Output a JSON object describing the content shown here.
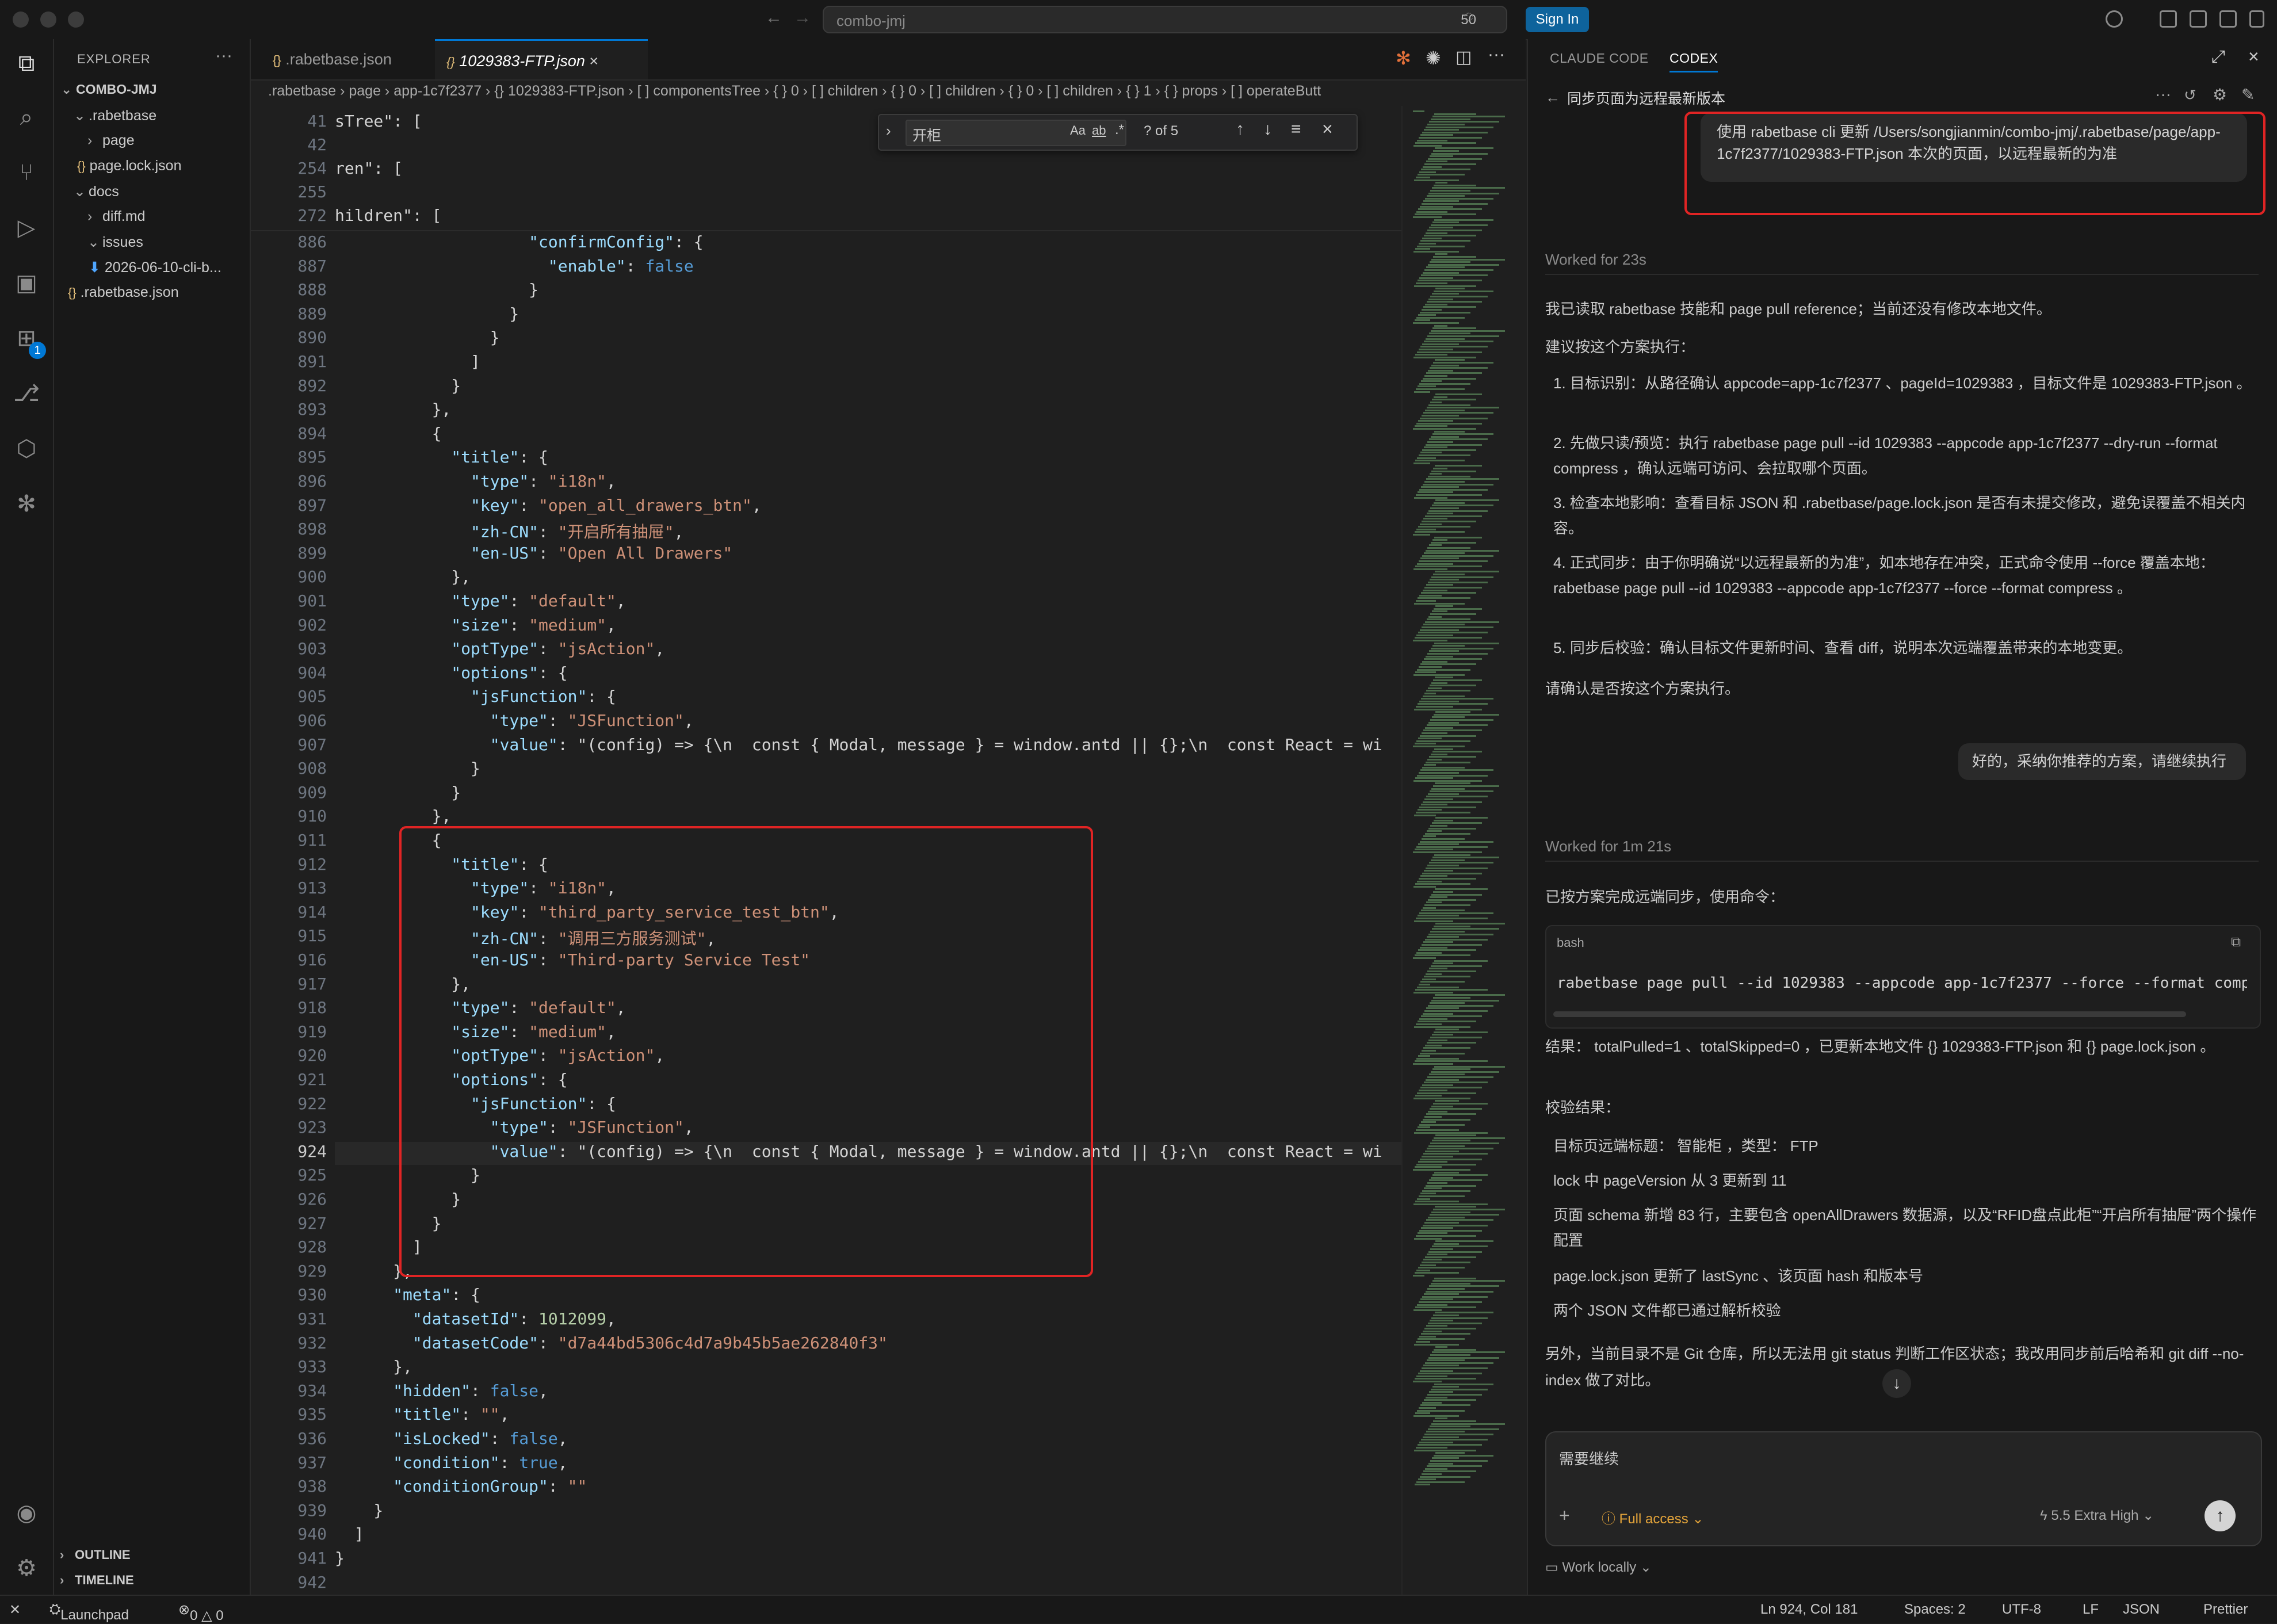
{
  "titlebar": {
    "command_center": "combo-jmj",
    "count": "50",
    "signin": "Sign In"
  },
  "activity": {
    "extensions_badge": "1"
  },
  "explorer": {
    "header": "EXPLORER",
    "root": "COMBO-JMJ",
    "items": [
      ".rabetbase",
      "page",
      "page.lock.json",
      "docs",
      "diff.md",
      "issues",
      "2026-06-10-cli-b...",
      ".rabetbase.json"
    ],
    "outline": "OUTLINE",
    "timeline": "TIMELINE"
  },
  "editor": {
    "tabs": [
      ".rabetbase.json",
      "1029383-FTP.json"
    ],
    "breadcrumb": ".rabetbase  ›  page  ›  app-1c7f2377  ›  {} 1029383-FTP.json  ›  [ ] componentsTree  ›  { } 0  ›  [ ] children  ›  { } 0  ›  [ ] children  ›  { } 0  ›  [ ] children  ›  { } 1  ›  { } props  ›  [ ] operateButt",
    "find": {
      "query": "开柜",
      "result": "? of 5"
    },
    "sticky": [
      {
        "n": "41",
        "t": "sTree\": ["
      },
      {
        "n": "42",
        "t": ""
      },
      {
        "n": "254",
        "t": "ren\": ["
      },
      {
        "n": "255",
        "t": ""
      },
      {
        "n": "272",
        "t": "hildren\": ["
      }
    ],
    "lines": [
      {
        "n": "886",
        "t": "                    \"confirmConfig\": {"
      },
      {
        "n": "887",
        "t": "                      \"enable\": false"
      },
      {
        "n": "888",
        "t": "                    }"
      },
      {
        "n": "889",
        "t": "                  }"
      },
      {
        "n": "890",
        "t": "                }"
      },
      {
        "n": "891",
        "t": "              ]"
      },
      {
        "n": "892",
        "t": "            }"
      },
      {
        "n": "893",
        "t": "          },"
      },
      {
        "n": "894",
        "t": "          {"
      },
      {
        "n": "895",
        "t": "            \"title\": {"
      },
      {
        "n": "896",
        "t": "              \"type\": \"i18n\","
      },
      {
        "n": "897",
        "t": "              \"key\": \"open_all_drawers_btn\","
      },
      {
        "n": "898",
        "t": "              \"zh-CN\": \"开启所有抽屉\","
      },
      {
        "n": "899",
        "t": "              \"en-US\": \"Open All Drawers\""
      },
      {
        "n": "900",
        "t": "            },"
      },
      {
        "n": "901",
        "t": "            \"type\": \"default\","
      },
      {
        "n": "902",
        "t": "            \"size\": \"medium\","
      },
      {
        "n": "903",
        "t": "            \"optType\": \"jsAction\","
      },
      {
        "n": "904",
        "t": "            \"options\": {"
      },
      {
        "n": "905",
        "t": "              \"jsFunction\": {"
      },
      {
        "n": "906",
        "t": "                \"type\": \"JSFunction\","
      },
      {
        "n": "907",
        "t": "                \"value\": \"(config) => {\\n  const { Modal, message } = window.antd || {};\\n  const React = wi"
      },
      {
        "n": "908",
        "t": "              }"
      },
      {
        "n": "909",
        "t": "            }"
      },
      {
        "n": "910",
        "t": "          },"
      },
      {
        "n": "911",
        "t": "          {"
      },
      {
        "n": "912",
        "t": "            \"title\": {"
      },
      {
        "n": "913",
        "t": "              \"type\": \"i18n\","
      },
      {
        "n": "914",
        "t": "              \"key\": \"third_party_service_test_btn\","
      },
      {
        "n": "915",
        "t": "              \"zh-CN\": \"调用三方服务测试\","
      },
      {
        "n": "916",
        "t": "              \"en-US\": \"Third-party Service Test\""
      },
      {
        "n": "917",
        "t": "            },"
      },
      {
        "n": "918",
        "t": "            \"type\": \"default\","
      },
      {
        "n": "919",
        "t": "            \"size\": \"medium\","
      },
      {
        "n": "920",
        "t": "            \"optType\": \"jsAction\","
      },
      {
        "n": "921",
        "t": "            \"options\": {"
      },
      {
        "n": "922",
        "t": "              \"jsFunction\": {"
      },
      {
        "n": "923",
        "t": "                \"type\": \"JSFunction\","
      },
      {
        "n": "924",
        "t": "                \"value\": \"(config) => {\\n  const { Modal, message } = window.antd || {};\\n  const React = wi"
      },
      {
        "n": "925",
        "t": "              }"
      },
      {
        "n": "926",
        "t": "            }"
      },
      {
        "n": "927",
        "t": "          }"
      },
      {
        "n": "928",
        "t": "        ]"
      },
      {
        "n": "929",
        "t": "      },"
      },
      {
        "n": "930",
        "t": "      \"meta\": {"
      },
      {
        "n": "931",
        "t": "        \"datasetId\": 1012099,"
      },
      {
        "n": "932",
        "t": "        \"datasetCode\": \"d7a44bd5306c4d7a9b45b5ae262840f3\""
      },
      {
        "n": "933",
        "t": "      },"
      },
      {
        "n": "934",
        "t": "      \"hidden\": false,"
      },
      {
        "n": "935",
        "t": "      \"title\": \"\","
      },
      {
        "n": "936",
        "t": "      \"isLocked\": false,"
      },
      {
        "n": "937",
        "t": "      \"condition\": true,"
      },
      {
        "n": "938",
        "t": "      \"conditionGroup\": \"\""
      },
      {
        "n": "939",
        "t": "    }"
      },
      {
        "n": "940",
        "t": "  ]"
      },
      {
        "n": "941",
        "t": "}"
      },
      {
        "n": "942",
        "t": ""
      }
    ]
  },
  "panel": {
    "tabs": [
      "CLAUDE CODE",
      "CODEX"
    ],
    "thread_title": "同步页面为远程最新版本",
    "user_msg_1": "使用 rabetbase cli 更新 /Users/songjianmin/combo-jmj/.rabetbase/page/app-1c7f2377/1029383-FTP.json 本次的页面，以远程最新的为准",
    "worked_1": "Worked for 23s",
    "para_1": "我已读取 rabetbase 技能和 page pull reference；当前还没有修改本地文件。",
    "para_2": "建议按这个方案执行：",
    "steps": [
      "1. 目标识别：从路径确认 appcode=app-1c7f2377 、pageId=1029383 ，目标文件是 1029383-FTP.json 。",
      "2. 先做只读/预览：执行 rabetbase page pull --id 1029383 --appcode app-1c7f2377 --dry-run --format compress ，确认远端可访问、会拉取哪个页面。",
      "3. 检查本地影响：查看目标 JSON 和 .rabetbase/page.lock.json 是否有未提交修改，避免误覆盖不相关内容。",
      "4. 正式同步：由于你明确说“以远程最新的为准”，如本地存在冲突，正式命令使用 --force 覆盖本地： rabetbase page pull --id 1029383 --appcode app-1c7f2377 --force --format compress 。",
      "5. 同步后校验：确认目标文件更新时间、查看 diff，说明本次远端覆盖带来的本地变更。"
    ],
    "para_3": "请确认是否按这个方案执行。",
    "user_msg_2": "好的，采纳你推荐的方案，请继续执行",
    "worked_2": "Worked for 1m 21s",
    "para_4": "已按方案完成远端同步，使用命令：",
    "code_lang": "bash",
    "code_cmd": "rabetbase page pull --id 1029383 --appcode app-1c7f2377 --force --format comp",
    "result_line": "结果： totalPulled=1 、totalSkipped=0 ，已更新本地文件 {} 1029383-FTP.json 和 {} page.lock.json 。",
    "verify_title": "校验结果：",
    "bullets": [
      "目标页远端标题： 智能柜 ，类型： FTP",
      "lock 中 pageVersion 从 3 更新到 11",
      "页面 schema 新增 83 行，主要包含 openAllDrawers 数据源，以及“RFID盘点此柜”“开启所有抽屉”两个操作配置",
      "page.lock.json 更新了 lastSync 、该页面 hash 和版本号",
      "两个 JSON 文件都已通过解析校验"
    ],
    "para_5": "另外，当前目录不是 Git 仓库，所以无法用 git status 判断工作区状态；我改用同步前后哈希和 git diff --no-index 做了对比。",
    "composer_text": "需要继续",
    "access": "Full access",
    "model": "5.5",
    "effort": "Extra High",
    "work_locally": "Work locally"
  },
  "statusbar": {
    "launchpad": "Launchpad",
    "problems": "0 △ 0",
    "position": "Ln 924, Col 181",
    "spaces": "Spaces: 2",
    "encoding": "UTF-8",
    "eol": "LF",
    "language": "JSON",
    "prettier": "Prettier"
  }
}
